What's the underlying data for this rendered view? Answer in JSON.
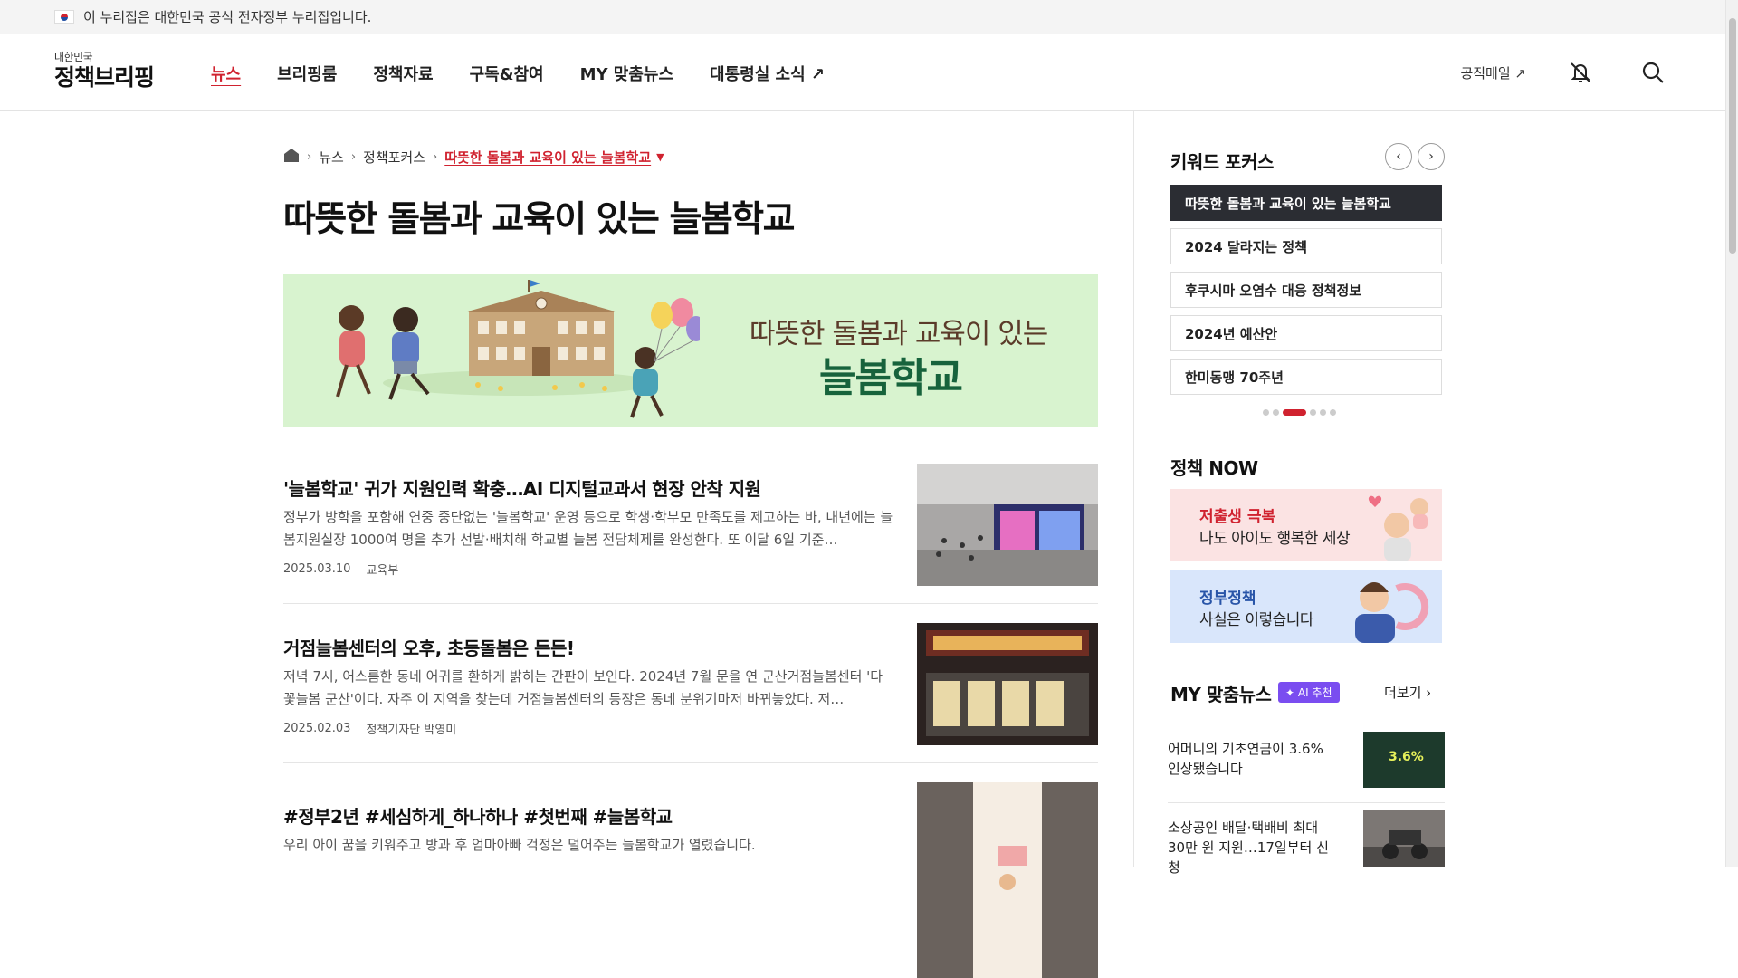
{
  "gov_banner": {
    "text": "이 누리집은 대한민국 공식 전자정부 누리집입니다."
  },
  "logo": {
    "small": "대한민국",
    "big": "정책브리핑"
  },
  "nav": {
    "items": [
      "뉴스",
      "브리핑룸",
      "정책자료",
      "구독&참여",
      "MY 맞춤뉴스",
      "대통령실 소식 ↗"
    ],
    "active": "뉴스"
  },
  "header_right": {
    "mail": "공직메일 ↗"
  },
  "breadcrumb": {
    "items": [
      "뉴스",
      "정책포커스"
    ],
    "current": "따뜻한 돌봄과 교육이 있는 늘봄학교",
    "caret": "▼"
  },
  "page_title": "따뜻한 돌봄과 교육이 있는 늘봄학교",
  "banner": {
    "line1": "따뜻한 돌봄과 교육이 있는",
    "line2": "늘봄학교"
  },
  "articles": [
    {
      "title": "'늘봄학교' 귀가 지원인력 확충…AI 디지털교과서 현장 안착 지원",
      "body": "정부가 방학을 포함해 연중 중단없는 '늘봄학교' 운영 등으로 학생·학부모 만족도를 제고하는 바, 내년에는 늘봄지원실장 1000여 명을 추가 선발·배치해 학교별 늘봄 전담체제를 완성한다. 또 이달 6일 기준…",
      "date": "2025.03.10",
      "source": "교육부"
    },
    {
      "title": "거점늘봄센터의 오후, 초등돌봄은 든든!",
      "body": "저녁 7시, 어스름한 동네 어귀를 환하게 밝히는 간판이 보인다. 2024년 7월 문을 연 군산거점늘봄센터 '다꽃늘봄 군산'이다. 자주 이 지역을 찾는데 거점늘봄센터의 등장은 동네 분위기마저 바뀌놓았다. 저…",
      "date": "2025.02.03",
      "source": "정책기자단 박영미"
    },
    {
      "title": "#정부2년 #세심하게_하나하나 #첫번째 #늘봄학교",
      "body": "우리 아이 꿈을 키워주고 방과 후 엄마아빠 걱정은 덜어주는 늘봄학교가 열렸습니다.",
      "date": "",
      "source": ""
    }
  ],
  "sidebar": {
    "keyword_heading": "키워드 포커스",
    "keywords": [
      "따뜻한 돌봄과 교육이 있는 늘봄학교",
      "2024 달라지는 정책",
      "후쿠시마 오염수 대응 정책정보",
      "2024년 예산안",
      "한미동맹 70주년"
    ],
    "active_keyword": 0,
    "policy_now_heading": "정책 NOW",
    "promos": [
      {
        "line1": "저출생 극복",
        "line2": "나도 아이도 행복한 세상"
      },
      {
        "line1": "정부정책",
        "line2": "사실은 이렇습니다"
      }
    ],
    "my_news_heading": "MY 맞춤뉴스",
    "ai_badge": "✦ AI 추천",
    "more": "더보기 ›",
    "my_news": [
      {
        "text": "어머니의 기초연금이 3.6% 인상됐습니다",
        "image_text": "3.6%"
      },
      {
        "text": "소상공인 배달·택배비 최대 30만 원 지원…17일부터 신청"
      }
    ]
  },
  "colors": {
    "accent": "#d0222f",
    "active_keyword_bg": "#2b2d33",
    "banner_bg": "#d8f3cf",
    "ai_badge": "#7a4df0"
  }
}
